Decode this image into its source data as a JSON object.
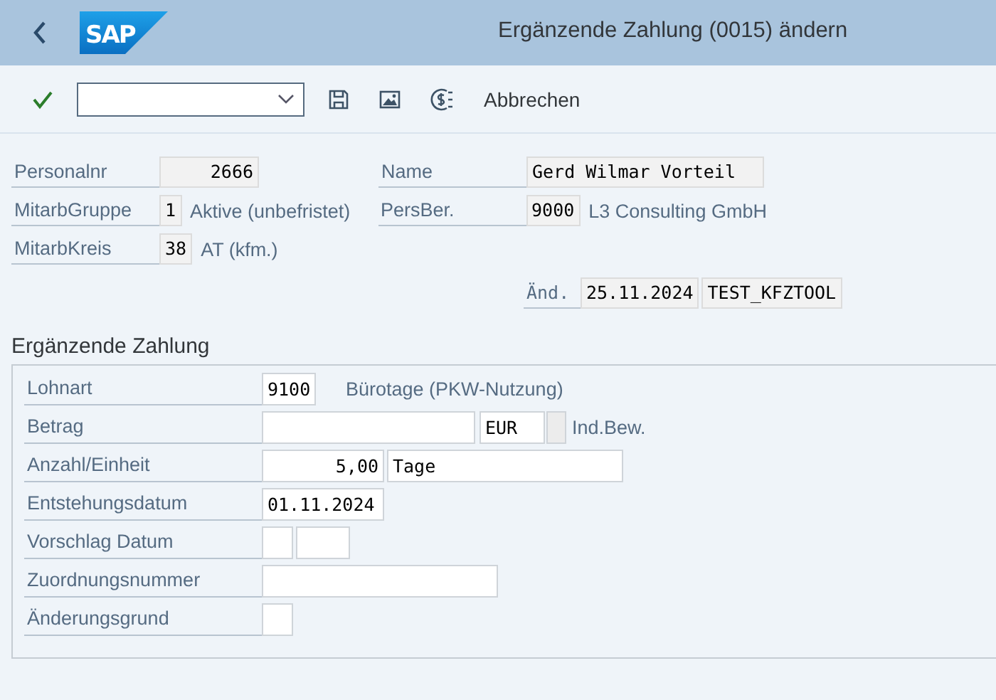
{
  "header": {
    "logo_text": "SAP",
    "title": "Ergänzende Zahlung (0015) ändern"
  },
  "toolbar": {
    "cancel_label": "Abbrechen"
  },
  "employee": {
    "personalnr": {
      "label": "Personalnr",
      "value": "2666"
    },
    "mitarbgruppe": {
      "label": "MitarbGruppe",
      "value": "1",
      "text": "Aktive (unbefristet)"
    },
    "mitarbkreis": {
      "label": "MitarbKreis",
      "value": "38",
      "text": "AT (kfm.)"
    },
    "name": {
      "label": "Name",
      "value": "Gerd Wilmar Vorteil"
    },
    "persber": {
      "label": "PersBer.",
      "value": "9000",
      "text": "L3 Consulting GmbH"
    },
    "changed": {
      "label": "Änd.",
      "date": "25.11.2024",
      "user": "TEST_KFZTOOL"
    }
  },
  "payment": {
    "title": "Ergänzende Zahlung",
    "rows": [
      {
        "label": "Lohnart",
        "fields": [
          {
            "value": "9100",
            "editable": true
          }
        ],
        "text": "Bürotage (PKW-Nutzung)"
      },
      {
        "label": "Betrag",
        "fields": [
          {
            "editable": true
          },
          {
            "value": "EUR",
            "editable": true
          },
          {
            "editable": false
          }
        ],
        "text": "Ind.Bew."
      },
      {
        "label": "Anzahl/Einheit",
        "fields": [
          {
            "value": "5,00",
            "editable": true
          },
          {
            "value": "Tage",
            "editable": true
          }
        ]
      },
      {
        "label": "Entstehungsdatum",
        "fields": [
          {
            "value": "01.11.2024",
            "editable": true
          }
        ]
      },
      {
        "label": "Vorschlag Datum",
        "fields": [
          {
            "editable": true
          },
          {
            "editable": true
          }
        ]
      },
      {
        "label": "Zuordnungsnummer",
        "fields": [
          {
            "editable": true
          }
        ]
      },
      {
        "label": "Änderungsgrund",
        "fields": [
          {
            "editable": true
          }
        ]
      }
    ]
  }
}
